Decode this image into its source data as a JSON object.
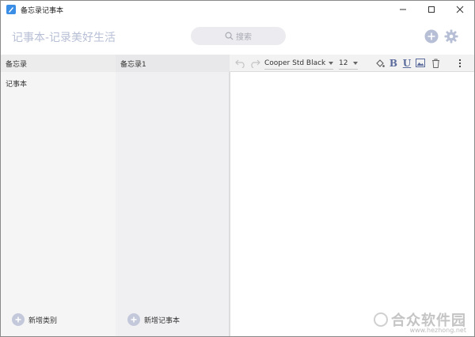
{
  "window": {
    "title": "备忘录记事本",
    "controls": {
      "minimize": "minimize-icon",
      "maximize": "maximize-icon",
      "close": "close-icon"
    }
  },
  "header": {
    "slogan": "记事本-记录美好生活",
    "search_placeholder": "搜索",
    "add_icon": "plus-circle-icon",
    "settings_icon": "gear-icon",
    "accent_color": "#b7bfd6"
  },
  "categories": {
    "title": "备忘录",
    "items": [
      "记事本"
    ],
    "add_label": "新增类别"
  },
  "notes": {
    "title": "备忘录1",
    "items": [],
    "add_label": "新增记事本"
  },
  "editor": {
    "font": "Cooper Std Black",
    "size": "12",
    "tools": [
      "undo-icon",
      "redo-icon",
      "fill-color-icon",
      "bold-icon",
      "underline-icon",
      "image-icon",
      "delete-icon",
      "more-icon"
    ],
    "bold_glyph": "B",
    "underline_glyph": "U"
  },
  "watermark": {
    "text": "合众软件园",
    "url": "www.hezhong.net"
  }
}
